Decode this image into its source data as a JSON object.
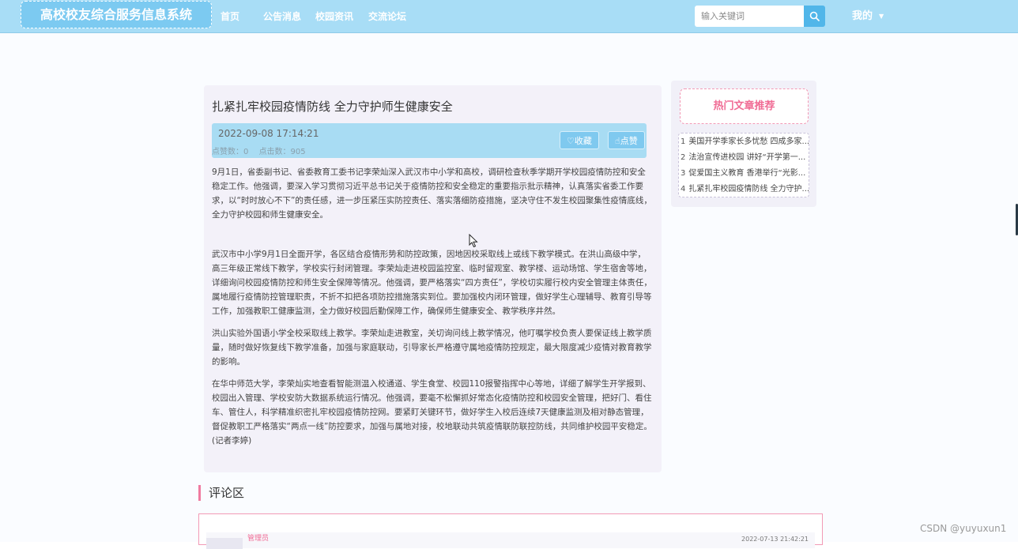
{
  "header": {
    "site_title": "高校校友综合服务信息系统",
    "nav": [
      "首页",
      "公告消息",
      "校园资讯",
      "交流论坛"
    ],
    "search_placeholder": "输入关键词",
    "user_menu": "我的"
  },
  "article": {
    "title": "扎紧扎牢校园疫情防线 全力守护师生健康安全",
    "date": "2022-09-08 17:14:21",
    "likes_label": "点赞数：0",
    "clicks_label": "点击数：905",
    "favorite_label": "收藏",
    "like_label": "点赞",
    "paragraphs": [
      "9月1日，省委副书记、省委教育工委书记李荣灿深入武汉市中小学和高校，调研检查秋季学期开学校园疫情防控和安全稳定工作。他强调，要深入学习贯彻习近平总书记关于疫情防控和安全稳定的重要指示批示精神，认真落实省委工作要求，以“时时放心不下”的责任感，进一步压紧压实防控责任、落实落细防疫措施，坚决守住不发生校园聚集性疫情底线，全力守护校园和师生健康安全。",
      "武汉市中小学9月1日全面开学，各区结合疫情形势和防控政策，因地因校采取线上或线下教学模式。在洪山高级中学，高三年级正常线下教学，学校实行封闭管理。李荣灿走进校园监控室、临时留观室、教学楼、运动场馆、学生宿舍等地，详细询问校园疫情防控和师生安全保障等情况。他强调，要严格落实“四方责任”，学校切实履行校内安全管理主体责任，属地履行疫情防控管理职责，不折不扣把各项防控措施落实到位。要加强校内闭环管理，做好学生心理辅导、教育引导等工作，加强教职工健康监测，全力做好校园后勤保障工作，确保师生健康安全、教学秩序井然。",
      "洪山实验外国语小学全校采取线上教学。李荣灿走进教室，关切询问线上教学情况，他叮嘱学校负责人要保证线上教学质量，随时做好恢复线下教学准备，加强与家庭联动，引导家长严格遵守属地疫情防控规定，最大限度减少疫情对教育教学的影响。",
      "在华中师范大学，李荣灿实地查看智能测温入校通道、学生食堂、校园110报警指挥中心等地，详细了解学生开学报到、校园出入管理、学校安防大数据系统运行情况。他强调，要毫不松懈抓好常态化疫情防控和校园安全管理，把好门、看住车、管住人，科学精准织密扎牢校园疫情防控网。要紧盯关键环节，做好学生入校后连续7天健康监测及相对静态管理，督促教职工严格落实“两点一线”防控要求，加强与属地对接，校地联动共筑疫情联防联控防线，共同维护校园平安稳定。(记者李婷)"
    ]
  },
  "hot": {
    "title": "热门文章推荐",
    "items": [
      {
        "num": "1",
        "text": "美国开学季家长多忧愁 四成多家..."
      },
      {
        "num": "2",
        "text": "法治宣传进校园 讲好“开学第一..."
      },
      {
        "num": "3",
        "text": "促爱国主义教育 香港举行“光影..."
      },
      {
        "num": "4",
        "text": "扎紧扎牢校园疫情防线 全力守护..."
      }
    ]
  },
  "comments": {
    "heading": "评论区",
    "first_user": "管理员",
    "first_time": "2022-07-13 21:42:21"
  },
  "watermark": "CSDN @yuyuxun1",
  "colors": {
    "nav_bg": "#a8ddf6",
    "accent_pink": "#f06b94",
    "button_blue": "#7fc9ef"
  }
}
